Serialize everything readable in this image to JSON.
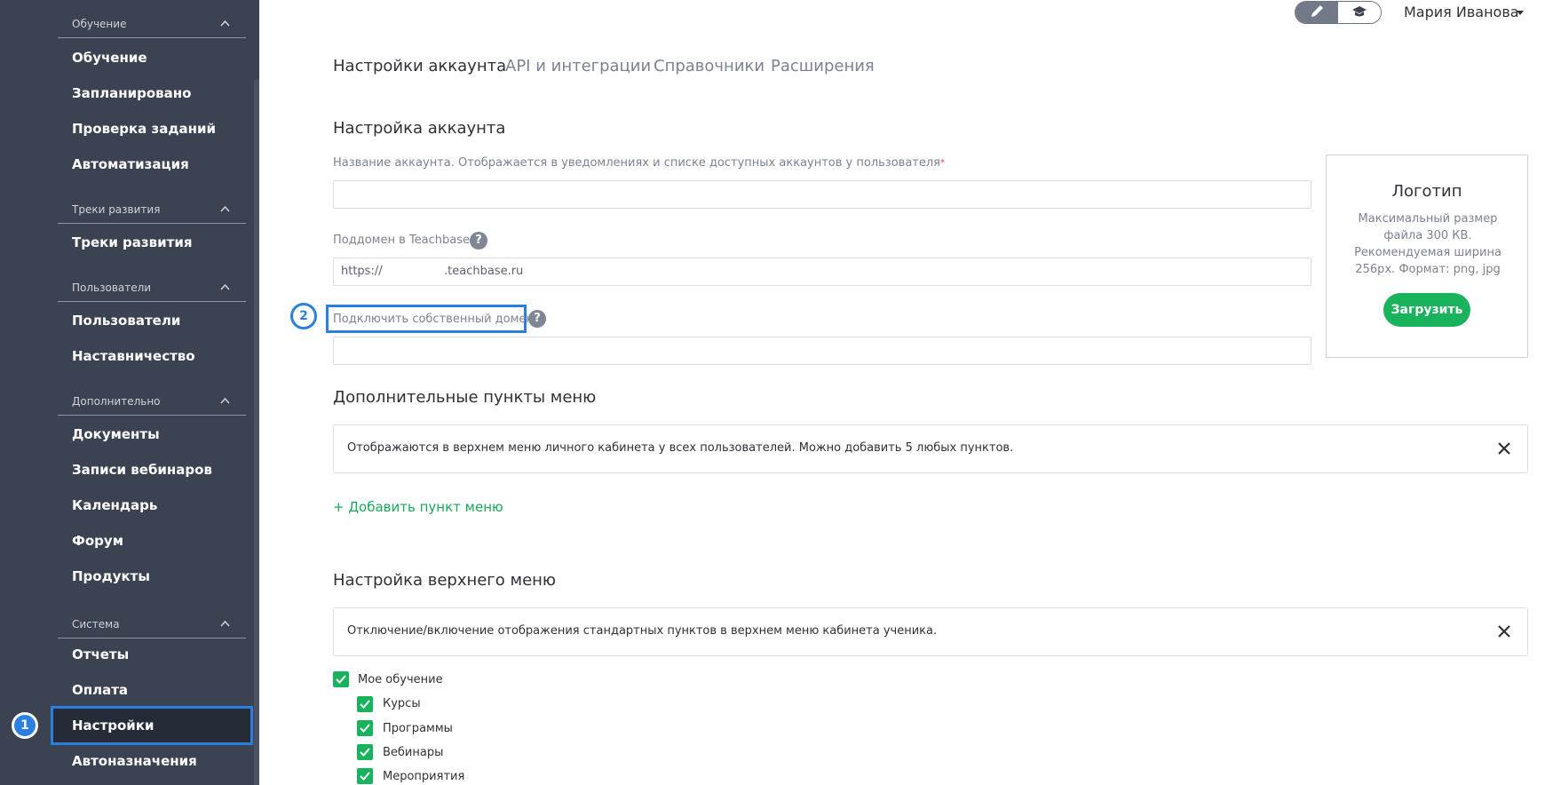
{
  "sidebar": {
    "sections": [
      {
        "title": "Обучение",
        "items": [
          "Обучение",
          "Запланировано",
          "Проверка заданий",
          "Автоматизация"
        ]
      },
      {
        "title": "Треки развития",
        "items": [
          "Треки развития"
        ]
      },
      {
        "title": "Пользователи",
        "items": [
          "Пользователи",
          "Наставничество"
        ]
      },
      {
        "title": "Дополнительно",
        "items": [
          "Документы",
          "Записи вебинаров",
          "Календарь",
          "Форум",
          "Продукты"
        ]
      },
      {
        "title": "Система",
        "items": [
          "Отчеты",
          "Оплата",
          "Настройки",
          "Автоназначения"
        ]
      }
    ],
    "active_item": "Настройки"
  },
  "steps": {
    "one": "1",
    "two": "2"
  },
  "topbar": {
    "user_name": "Мария Иванова"
  },
  "tabs": [
    "Настройки аккаунта",
    "API и интеграции",
    "Справочники",
    "Расширения"
  ],
  "account": {
    "heading": "Настройка аккаунта",
    "name_label": "Название аккаунта. Отображается в уведомлениях и списке доступных аккаунтов у пользователя",
    "required_mark": "*",
    "subdomain_label": "Поддомен в Teachbase",
    "subdomain_prefix": "https://",
    "subdomain_suffix": ".teachbase.ru",
    "own_domain_label": "Подключить собственный домен",
    "help_glyph": "?"
  },
  "logo": {
    "title": "Логотип",
    "desc": "Максимальный размер файла 300 КВ. Рекомендуемая ширина 256px. Формат: png, jpg",
    "upload_label": "Загрузить"
  },
  "extra_menu": {
    "heading": "Дополнительные пункты меню",
    "info": "Отображаются в верхнем меню личного кабинета у всех пользователей. Можно добавить 5 любых пунктов.",
    "add_label": "+ Добавить пункт меню"
  },
  "top_menu": {
    "heading": "Настройка верхнего меню",
    "info": "Отключение/включение отображения стандартных пунктов в верхнем меню кабинета ученика.",
    "parent": "Мое обучение",
    "children": [
      "Курсы",
      "Программы",
      "Вебинары",
      "Мероприятия"
    ]
  },
  "colors": {
    "accent_green": "#19b35e",
    "highlight_blue": "#2b7fe0",
    "sidebar_bg": "#3b4251"
  }
}
